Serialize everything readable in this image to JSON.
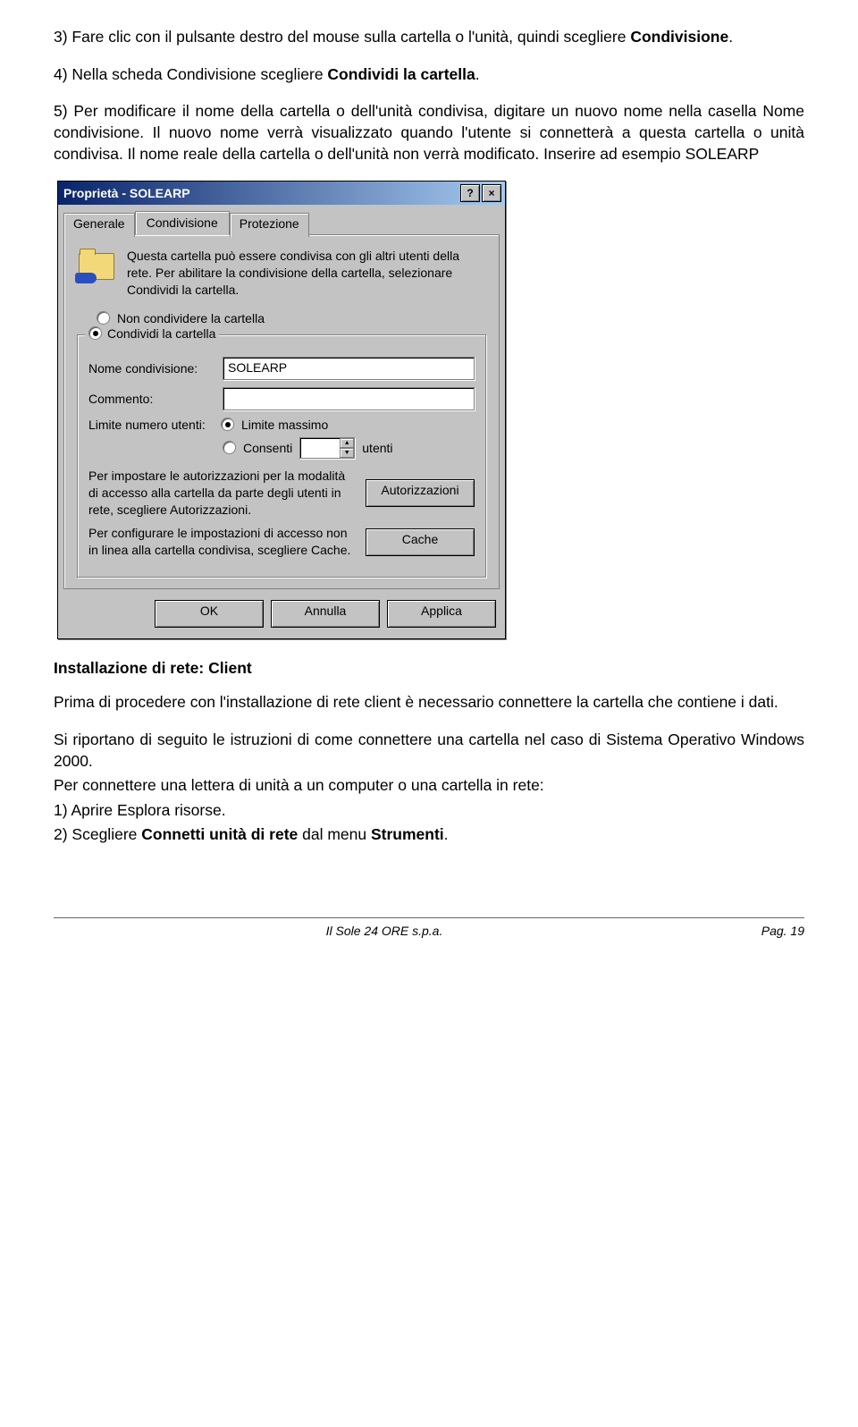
{
  "doc": {
    "p3_a": "3) Fare clic con il pulsante destro del mouse sulla cartella o l'unità, quindi scegliere ",
    "p3_b": "Condivisione",
    "p3_c": ".",
    "p4_a": "4) Nella scheda Condivisione scegliere ",
    "p4_b": "Condividi la cartella",
    "p4_c": ".",
    "p5": "5) Per modificare il nome della cartella o dell'unità condivisa, digitare un nuovo nome nella casella Nome condivisione. Il nuovo nome verrà visualizzato quando l'utente si connetterà a questa cartella o unità condivisa. Il nome reale della cartella o dell'unità non verrà modificato. Inserire ad esempio SOLEARP",
    "heading_install": "Installazione di rete: Client",
    "p_install1": "Prima di procedere con l'installazione di rete client è necessario connettere la cartella che contiene i dati.",
    "p_install2": "Si riportano di seguito le istruzioni di come connettere una cartella nel caso di Sistema Operativo Windows 2000.",
    "p_install3": "Per connettere una lettera di unità a un computer o una cartella in rete:",
    "p_install4": "1) Aprire Esplora risorse.",
    "p_install5_a": "2) Scegliere ",
    "p_install5_b": "Connetti unità di rete",
    "p_install5_c": " dal menu ",
    "p_install5_d": "Strumenti",
    "p_install5_e": "."
  },
  "dialog": {
    "title": "Proprietà - SOLEARP",
    "help_symbol": "?",
    "close_symbol": "×",
    "tabs": {
      "generale": "Generale",
      "condivisione": "Condivisione",
      "protezione": "Protezione"
    },
    "description": "Questa cartella può essere condivisa con gli altri utenti della rete. Per abilitare la condivisione della cartella, selezionare Condividi la cartella.",
    "radio_non_condividere": "Non condividere la cartella",
    "radio_condividi": "Condividi la cartella",
    "nome_cond_label": "Nome condivisione:",
    "nome_cond_value": "SOLEARP",
    "commento_label": "Commento:",
    "commento_value": "",
    "limite_label": "Limite numero utenti:",
    "limite_massimo": "Limite massimo",
    "consenti": "Consenti",
    "utenti_suffix": "utenti",
    "auth_desc": "Per impostare le autorizzazioni per la modalità di accesso alla cartella da parte degli utenti in rete, scegliere Autorizzazioni.",
    "auth_btn": "Autorizzazioni",
    "cache_desc": "Per configurare le impostazioni di accesso non in linea alla cartella condivisa, scegliere Cache.",
    "cache_btn": "Cache",
    "ok": "OK",
    "annulla": "Annulla",
    "applica": "Applica"
  },
  "footer": {
    "center": "Il Sole 24 ORE s.p.a.",
    "right": "Pag. 19"
  }
}
